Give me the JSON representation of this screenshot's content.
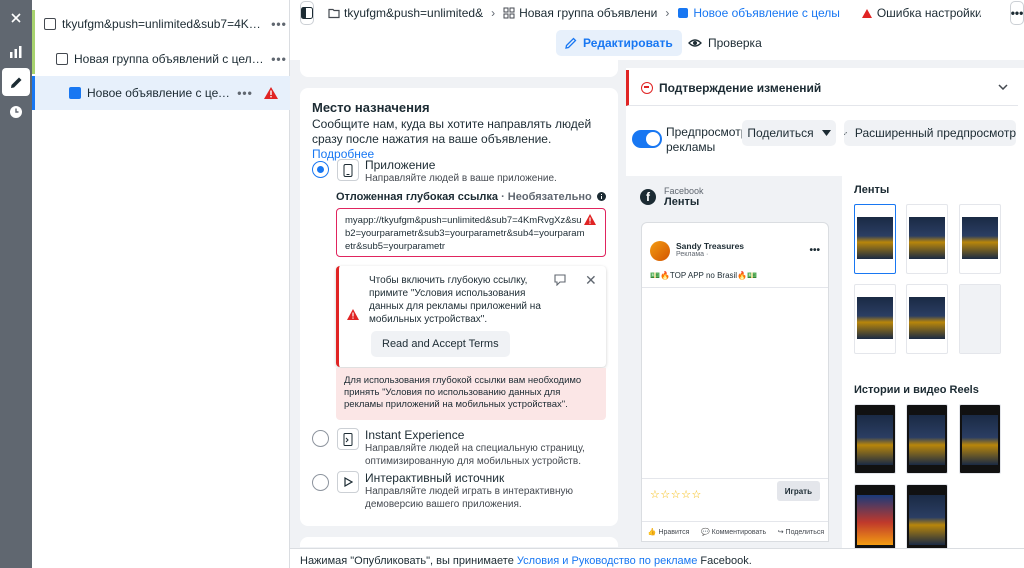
{
  "tree": {
    "campaign": "tkyufgm&push=unlimited&sub7=4KmR...",
    "adset": "Новая группа объявлений с целью ...",
    "ad": "Новое объявление с целью...",
    "more": "•••"
  },
  "topbar": {
    "crumb_campaign": "tkyufgm&push=unlimited&",
    "crumb_adset": "Новая группа объявлени",
    "crumb_ad": "Новое объявление с целы",
    "error_label": "Ошибка настройки",
    "more": "•••"
  },
  "modes": {
    "edit": "Редактировать",
    "check": "Проверка"
  },
  "destination": {
    "title": "Место назначения",
    "description": "Сообщите нам, куда вы хотите направлять людей сразу после нажатия на ваше объявление.",
    "learn_more": "Подробнее",
    "options": [
      {
        "title": "Приложение",
        "desc": "Направляйте людей в ваше приложение.",
        "selected": true
      },
      {
        "title": "Instant Experience",
        "desc": "Направляйте людей на специальную страницу, оптимизированную для мобильных устройств.",
        "selected": false
      },
      {
        "title": "Интерактивный источник",
        "desc": "Направляйте людей играть в интерактивную демоверсию вашего приложения.",
        "selected": false
      }
    ],
    "deep_link_title": "Отложенная глубокая ссылка",
    "deep_link_optional": "· Необязательно",
    "deep_link_value": "myapp://tkyufgm&push=unlimited&sub7=4KmRvgXz&sub2=yourparametr&sub3=yourparametr&sub4=yourparametr&sub5=yourparametr",
    "notice_text": "Чтобы включить глубокую ссылку, примите \"Условия использования данных для рекламы приложений на мобильных устройствах\".",
    "notice_button": "Read and Accept Terms",
    "error_text": "Для использования глубокой ссылки вам необходимо принять \"Условия по использованию данных для рекламы приложений на мобильных устройствах\"."
  },
  "footer": {
    "before": "Нажимая \"Опубликовать\", вы принимаете ",
    "link": "Условия и Руководство по рекламе",
    "after": " Facebook."
  },
  "preview": {
    "confirm_title": "Подтверждение изменений",
    "preview_label": "Предпросмотр рекламы",
    "share": "Поделиться",
    "advanced": "Расширенный предпросмотр",
    "fb_label": "Facebook",
    "fb_title": "Ленты",
    "post_name": "Sandy Treasures",
    "post_sub": "Реклама · ",
    "post_text": "💵🔥TOP APP no Brasil🔥💵",
    "stars": "☆☆☆☆☆",
    "play": "Играть",
    "like": "Нравится",
    "comment": "Комментировать",
    "share_action": "Поделиться",
    "feeds_title": "Ленты",
    "stories_title": "Истории и видео Reels"
  },
  "colors": {
    "accent": "#1877f2",
    "error": "#e02424",
    "success_bar": "#a8d36f"
  }
}
